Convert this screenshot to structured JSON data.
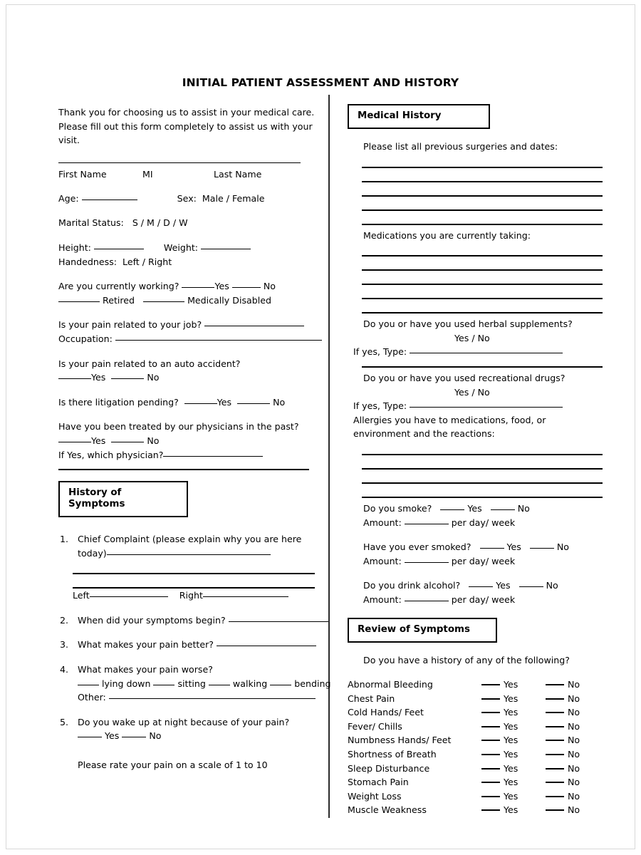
{
  "document": {
    "title": "INITIAL PATIENT ASSESSMENT AND HISTORY"
  },
  "left_column": {
    "intro": {
      "line1": "Thank you for choosing us to assist in your medical care.",
      "line2": "Please fill out this form completely to assist us with your",
      "line3": "visit."
    },
    "name_fields": {
      "first_name": "First Name",
      "middle_initial": "MI",
      "last_name": "Last Name"
    },
    "demographics": {
      "age_label": "Age:",
      "sex_label": "Sex:",
      "sex_options": "Male / Female",
      "marital_label": "Marital Status:",
      "marital_options": "S / M / D / W",
      "height_label": "Height:",
      "weight_label": "Weight:",
      "handedness_label": "Handedness:",
      "handedness_options": "Left / Right"
    },
    "work": {
      "question": "Are you currently working?",
      "yes": "Yes",
      "no": "No",
      "retired": "Retired",
      "medically_disabled": "Medically Disabled"
    },
    "job_pain": {
      "question": "Is your pain related to your job?",
      "occupation_label": "Occupation:"
    },
    "auto_accident": {
      "question": "Is your pain related to an auto accident?",
      "yes": "Yes",
      "no": "No"
    },
    "litigation": {
      "question": "Is there litigation pending?",
      "yes": "Yes",
      "no": "No"
    },
    "prior_treatment": {
      "question": "Have you been treated by our physicians in the past?",
      "yes": "Yes",
      "no": "No",
      "which_physician": "If Yes, which physician?"
    },
    "history_of_symptoms": {
      "heading": "History of Symptoms",
      "q1": {
        "number": "1.",
        "text_line1": "Chief Complaint (please explain why you are here",
        "text_line2": "today)",
        "left_label": "Left",
        "right_label": "Right"
      },
      "q2": {
        "number": "2.",
        "text": "When did your symptoms begin?"
      },
      "q3": {
        "number": "3.",
        "text": "What makes your pain better?"
      },
      "q4": {
        "number": "4.",
        "text": "What makes your pain worse?",
        "option_lying_down": "lying down",
        "option_sitting": "sitting",
        "option_walking": "walking",
        "option_bending": "bending",
        "other_label": "Other:"
      },
      "q5": {
        "number": "5.",
        "text": "Do you wake up at night because of your pain?",
        "yes": "Yes",
        "no": "No"
      },
      "pain_scale": "Please rate your pain on a scale of 1 to 10"
    }
  },
  "right_column": {
    "medical_history": {
      "heading": "Medical History",
      "surgeries_prompt": "Please list all previous surgeries and dates:",
      "surgeries_line_count": 5,
      "medications_prompt": "Medications you are currently taking:",
      "medications_line_count": 5,
      "herbal": {
        "question": "Do you or have you used herbal supplements?",
        "yes_no": "Yes / No",
        "if_yes_label": "If yes,  Type:"
      },
      "recreational": {
        "question": "Do you or have you used recreational drugs?",
        "yes_no": "Yes / No",
        "if_yes_label": "If yes,  Type:"
      },
      "allergies": {
        "prompt_line1": "Allergies you have to medications, food, or",
        "prompt_line2": "environment and the reactions:",
        "line_count": 4
      },
      "smoke": {
        "question": "Do you smoke?",
        "yes": "Yes",
        "no": "No",
        "amount_label": "Amount:",
        "per_label": "per day/ week"
      },
      "ever_smoked": {
        "question": "Have you ever smoked?",
        "yes": "Yes",
        "no": "No",
        "amount_label": "Amount:",
        "per_label": "per day/ week"
      },
      "alcohol": {
        "question": "Do you drink alcohol?",
        "yes": "Yes",
        "no": "No",
        "amount_label": "Amount:",
        "per_label": "per day/ week"
      }
    },
    "review_of_symptoms": {
      "heading": "Review of Symptoms",
      "prompt": "Do you have a history of any of the following?",
      "yes_label": "Yes",
      "no_label": "No",
      "items": [
        "Abnormal Bleeding",
        "Chest Pain",
        "Cold Hands/ Feet",
        "Fever/ Chills",
        "Numbness Hands/ Feet",
        "Shortness of Breath",
        "Sleep Disturbance",
        "Stomach Pain",
        "Weight Loss",
        "Muscle Weakness"
      ]
    }
  },
  "colors": {
    "text": "#000000",
    "page_background": "#ffffff",
    "rule": "#000000",
    "page_frame": "#d8d8d8"
  }
}
